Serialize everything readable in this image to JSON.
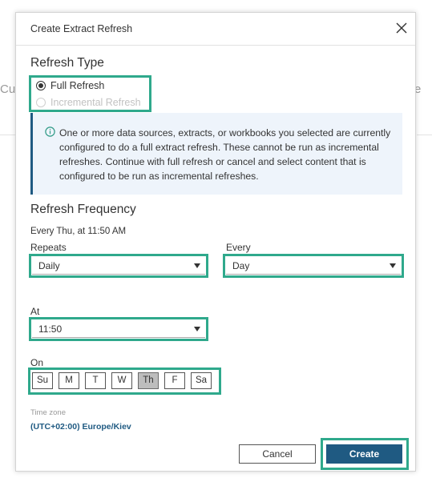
{
  "background": {
    "left_text": "Cus",
    "right_text": "e"
  },
  "dialog": {
    "title": "Create Extract Refresh"
  },
  "refresh_type": {
    "title": "Refresh Type",
    "options": [
      {
        "label": "Full Refresh",
        "checked": true,
        "disabled": false
      },
      {
        "label": "Incremental Refresh",
        "checked": false,
        "disabled": true
      }
    ]
  },
  "info": {
    "icon": "info-icon",
    "message": "One or more data sources, extracts, or workbooks you selected are currently configured to do a full extract refresh. These cannot be run as incremental refreshes. Continue with full refresh or cancel and select content that is configured to be run as incremental refreshes."
  },
  "frequency": {
    "title": "Refresh Frequency",
    "summary": "Every Thu, at 11:50 AM",
    "repeats_label": "Repeats",
    "repeats_value": "Daily",
    "every_label": "Every",
    "every_value": "Day",
    "at_label": "At",
    "at_value": "11:50",
    "on_label": "On",
    "days": [
      {
        "label": "Su",
        "selected": false
      },
      {
        "label": "M",
        "selected": false
      },
      {
        "label": "T",
        "selected": false
      },
      {
        "label": "W",
        "selected": false
      },
      {
        "label": "Th",
        "selected": true
      },
      {
        "label": "F",
        "selected": false
      },
      {
        "label": "Sa",
        "selected": false
      }
    ]
  },
  "timezone": {
    "label": "Time zone",
    "value": "(UTC+02:00) Europe/Kiev"
  },
  "buttons": {
    "cancel": "Cancel",
    "create": "Create"
  },
  "colors": {
    "accent": "#1f5a82",
    "highlight": "#2fa98c",
    "info_bg": "#eef4fb"
  }
}
